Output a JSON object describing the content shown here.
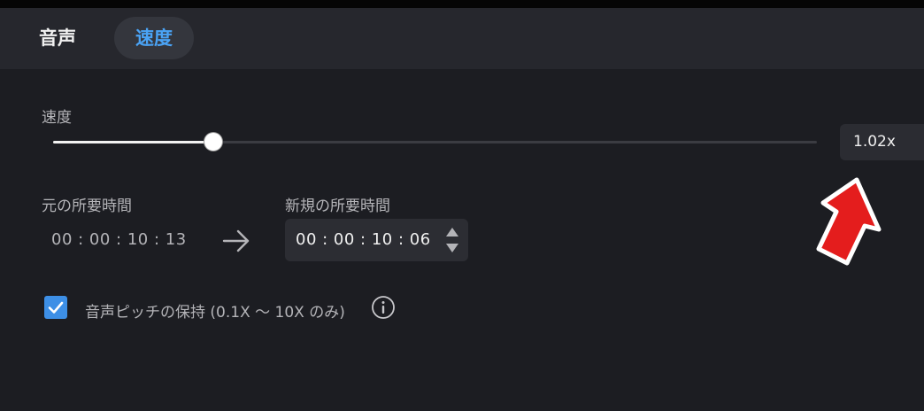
{
  "tabs": [
    {
      "label": "音声",
      "active": false
    },
    {
      "label": "速度",
      "active": true
    }
  ],
  "speed": {
    "label": "速度",
    "value": "1.02x",
    "slider_fraction": 0.21
  },
  "duration": {
    "original_label": "元の所要時間",
    "original_value": "00 : 00 : 10 : 13",
    "new_label": "新規の所要時間",
    "new_value": "00 : 00 : 10 : 06"
  },
  "pitch": {
    "label": "音声ピッチの保持 (0.1X 〜 10X のみ)",
    "checked": true
  },
  "icons": {
    "arrow": "arrow-right-icon",
    "info": "info-icon",
    "check": "checkmark-icon",
    "spin_up": "triangle-up-icon",
    "spin_down": "triangle-down-icon",
    "annotation": "red-arrow-annotation-icon"
  },
  "colors": {
    "accent": "#4aa3f5",
    "checkbox": "#3d8fe6",
    "annotation": "#e41d1d"
  }
}
